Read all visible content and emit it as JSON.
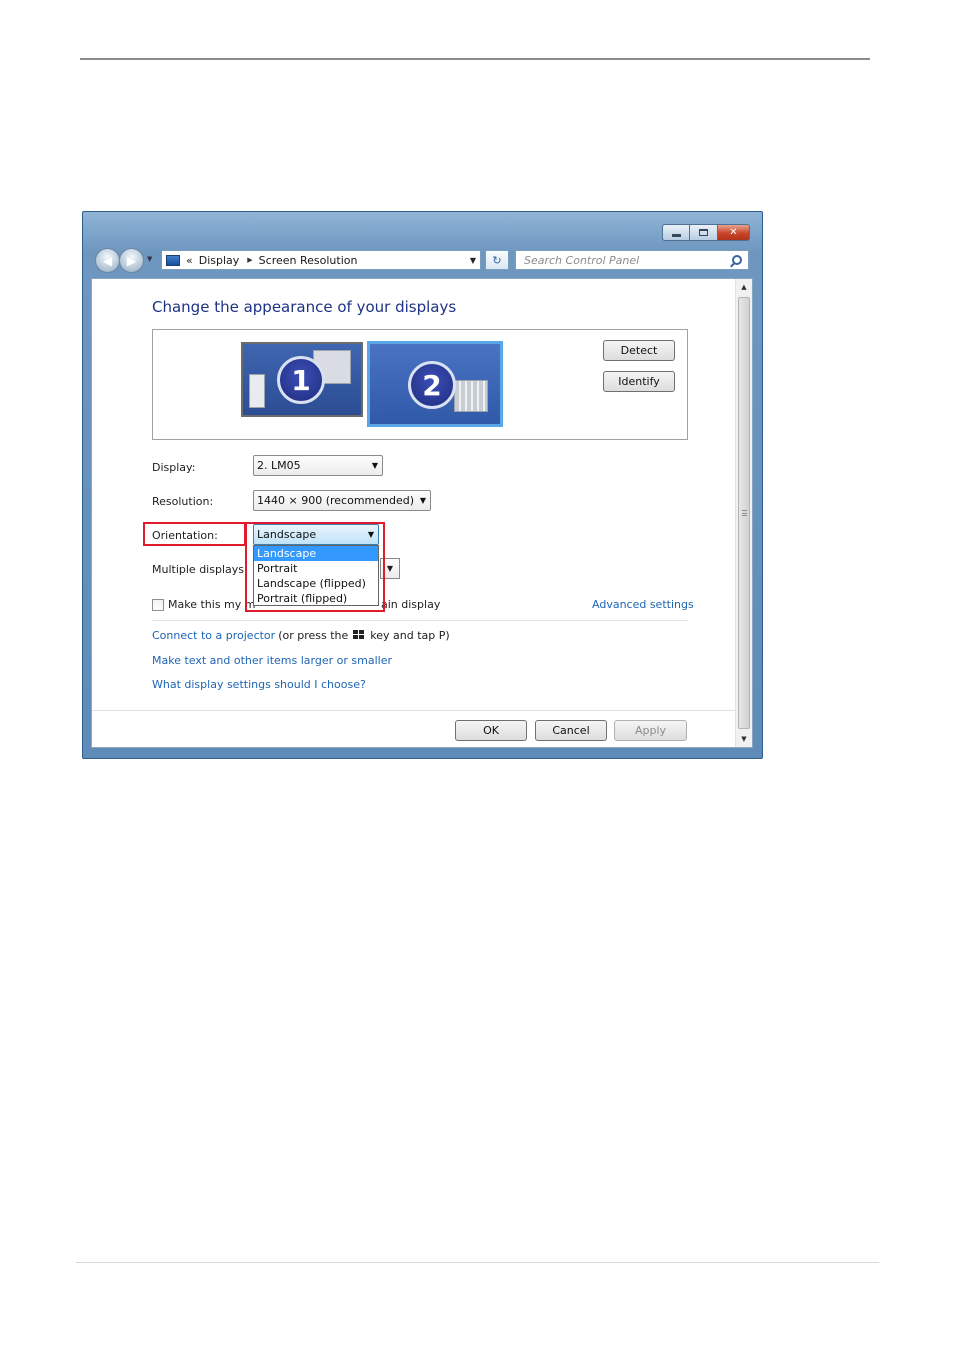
{
  "window": {
    "minimize_glyph": "",
    "maximize_glyph": "",
    "close_glyph": "✕"
  },
  "nav": {
    "back_glyph": "◀",
    "forward_glyph": "▶",
    "breadcrumb_prefix": "«",
    "breadcrumb": [
      "Display",
      "Screen Resolution"
    ],
    "refresh_glyph": "↻",
    "search_placeholder": "Search Control Panel"
  },
  "main": {
    "title": "Change the appearance of your displays",
    "monitors": [
      {
        "number": "1",
        "selected": false
      },
      {
        "number": "2",
        "selected": true
      }
    ],
    "detect_label": "Detect",
    "identify_label": "Identify",
    "display_label": "Display:",
    "display_value": "2. LM05",
    "resolution_label": "Resolution:",
    "resolution_value": "1440 × 900 (recommended)",
    "orientation_label": "Orientation:",
    "orientation_value": "Landscape",
    "orientation_options": [
      "Landscape",
      "Portrait",
      "Landscape (flipped)",
      "Portrait (flipped)"
    ],
    "orientation_selected_index": 0,
    "multiple_displays_label": "Multiple displays:",
    "main_display_label_start": "Make this my m",
    "main_display_label_end": "ain display",
    "advanced_settings_link": "Advanced settings",
    "projector_link": "Connect to a projector",
    "projector_text_before": "(or press the",
    "projector_text_after": "key and tap P)",
    "text_size_link": "Make text and other items larger or smaller",
    "choose_settings_link": "What display settings should I choose?"
  },
  "footer": {
    "ok_label": "OK",
    "cancel_label": "Cancel",
    "apply_label": "Apply"
  },
  "colors": {
    "title_blue": "#1e3287",
    "link_blue": "#1e64b4",
    "highlight_red": "#e01b2e",
    "selection_blue": "#3399ff"
  }
}
